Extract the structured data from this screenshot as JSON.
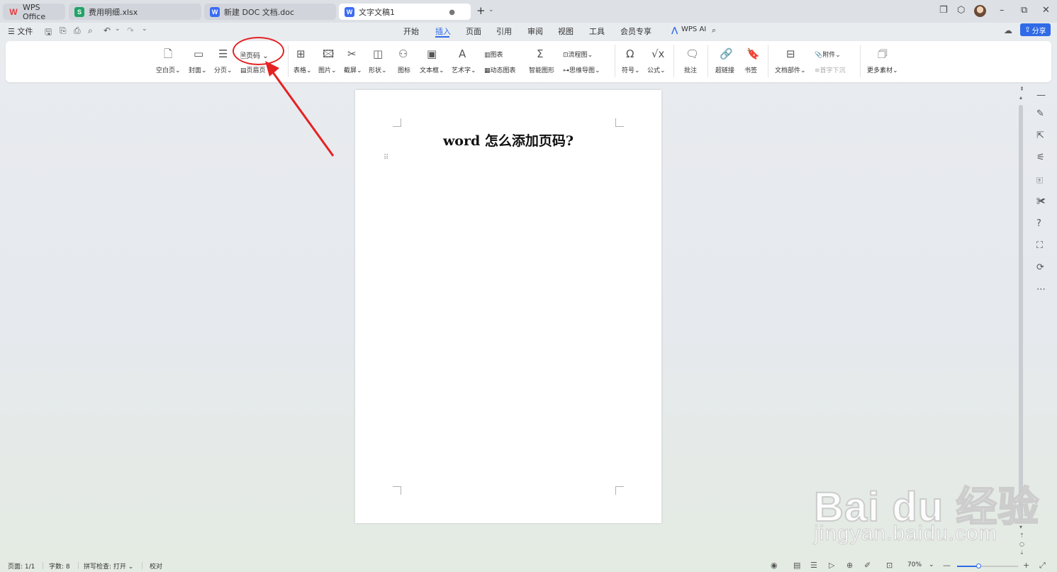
{
  "tabs": [
    {
      "icon": "W",
      "label": "WPS Office"
    },
    {
      "icon": "S",
      "label": "费用明细.xlsx"
    },
    {
      "icon": "W",
      "label": "新建 DOC 文档.doc"
    },
    {
      "icon": "W",
      "label": "文字文稿1",
      "active": true
    }
  ],
  "tab_new": "+",
  "menu": {
    "file_label": "☰ 文件",
    "items": [
      "开始",
      "插入",
      "页面",
      "引用",
      "审阅",
      "视图",
      "工具",
      "会员专享"
    ],
    "active": "插入",
    "wps_ai": "WPS AI",
    "share": "分享"
  },
  "ribbon": {
    "blank_page": "空白页",
    "cover": "封面",
    "page_break": "分页",
    "page_number": "页码",
    "header_footer": "页眉页",
    "table": "表格",
    "picture": "图片",
    "screenshot": "截屏",
    "shape": "形状",
    "icon": "图标",
    "textbox": "文本框",
    "wordart": "艺术字",
    "chart": "图表",
    "dynamic_chart": "动态图表",
    "smart_graphic": "智能图形",
    "flowchart": "流程图",
    "mindmap": "思维导图",
    "symbol": "符号",
    "formula": "公式",
    "comment": "批注",
    "hyperlink": "超链接",
    "bookmark": "书签",
    "doc_parts": "文档部件",
    "attachment": "附件",
    "drop_cap": "首字下沉",
    "more_materials": "更多素材"
  },
  "document": {
    "title": "word 怎么添加页码?"
  },
  "status": {
    "page": "页面: 1/1",
    "words": "字数: 8",
    "spellcheck": "拼写检查: 打开",
    "proofread": "校对",
    "zoom": "70%",
    "zoom_fraction": 0.35
  },
  "watermark": {
    "brand": "Bai du 经验",
    "url": "jingyan.baidu.com"
  },
  "colors": {
    "accent": "#2f6be6",
    "annotation": "#e52222"
  }
}
